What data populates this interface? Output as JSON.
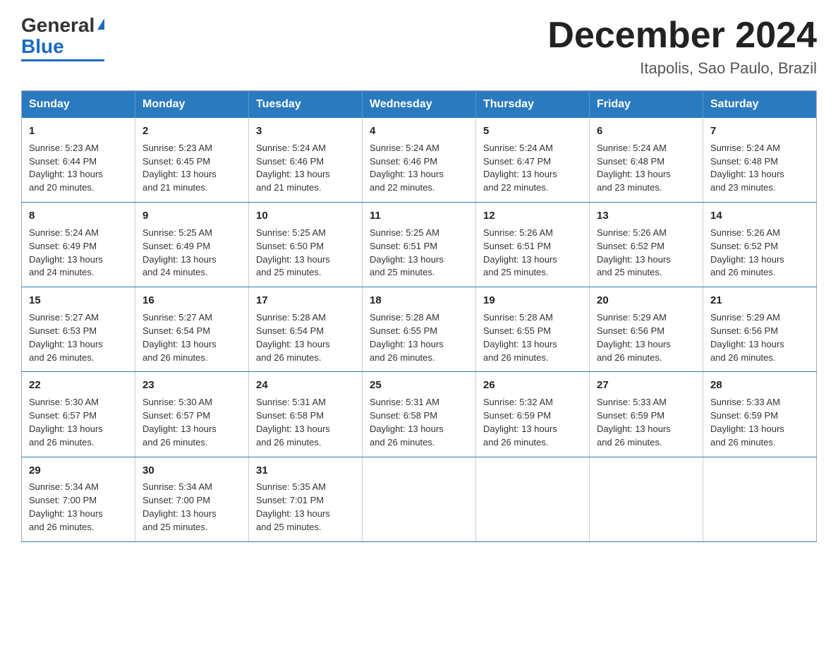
{
  "logo": {
    "general": "General",
    "blue": "Blue"
  },
  "title": "December 2024",
  "subtitle": "Itapolis, Sao Paulo, Brazil",
  "weekdays": [
    "Sunday",
    "Monday",
    "Tuesday",
    "Wednesday",
    "Thursday",
    "Friday",
    "Saturday"
  ],
  "weeks": [
    [
      {
        "day": "1",
        "sunrise": "5:23 AM",
        "sunset": "6:44 PM",
        "daylight": "13 hours and 20 minutes."
      },
      {
        "day": "2",
        "sunrise": "5:23 AM",
        "sunset": "6:45 PM",
        "daylight": "13 hours and 21 minutes."
      },
      {
        "day": "3",
        "sunrise": "5:24 AM",
        "sunset": "6:46 PM",
        "daylight": "13 hours and 21 minutes."
      },
      {
        "day": "4",
        "sunrise": "5:24 AM",
        "sunset": "6:46 PM",
        "daylight": "13 hours and 22 minutes."
      },
      {
        "day": "5",
        "sunrise": "5:24 AM",
        "sunset": "6:47 PM",
        "daylight": "13 hours and 22 minutes."
      },
      {
        "day": "6",
        "sunrise": "5:24 AM",
        "sunset": "6:48 PM",
        "daylight": "13 hours and 23 minutes."
      },
      {
        "day": "7",
        "sunrise": "5:24 AM",
        "sunset": "6:48 PM",
        "daylight": "13 hours and 23 minutes."
      }
    ],
    [
      {
        "day": "8",
        "sunrise": "5:24 AM",
        "sunset": "6:49 PM",
        "daylight": "13 hours and 24 minutes."
      },
      {
        "day": "9",
        "sunrise": "5:25 AM",
        "sunset": "6:49 PM",
        "daylight": "13 hours and 24 minutes."
      },
      {
        "day": "10",
        "sunrise": "5:25 AM",
        "sunset": "6:50 PM",
        "daylight": "13 hours and 25 minutes."
      },
      {
        "day": "11",
        "sunrise": "5:25 AM",
        "sunset": "6:51 PM",
        "daylight": "13 hours and 25 minutes."
      },
      {
        "day": "12",
        "sunrise": "5:26 AM",
        "sunset": "6:51 PM",
        "daylight": "13 hours and 25 minutes."
      },
      {
        "day": "13",
        "sunrise": "5:26 AM",
        "sunset": "6:52 PM",
        "daylight": "13 hours and 25 minutes."
      },
      {
        "day": "14",
        "sunrise": "5:26 AM",
        "sunset": "6:52 PM",
        "daylight": "13 hours and 26 minutes."
      }
    ],
    [
      {
        "day": "15",
        "sunrise": "5:27 AM",
        "sunset": "6:53 PM",
        "daylight": "13 hours and 26 minutes."
      },
      {
        "day": "16",
        "sunrise": "5:27 AM",
        "sunset": "6:54 PM",
        "daylight": "13 hours and 26 minutes."
      },
      {
        "day": "17",
        "sunrise": "5:28 AM",
        "sunset": "6:54 PM",
        "daylight": "13 hours and 26 minutes."
      },
      {
        "day": "18",
        "sunrise": "5:28 AM",
        "sunset": "6:55 PM",
        "daylight": "13 hours and 26 minutes."
      },
      {
        "day": "19",
        "sunrise": "5:28 AM",
        "sunset": "6:55 PM",
        "daylight": "13 hours and 26 minutes."
      },
      {
        "day": "20",
        "sunrise": "5:29 AM",
        "sunset": "6:56 PM",
        "daylight": "13 hours and 26 minutes."
      },
      {
        "day": "21",
        "sunrise": "5:29 AM",
        "sunset": "6:56 PM",
        "daylight": "13 hours and 26 minutes."
      }
    ],
    [
      {
        "day": "22",
        "sunrise": "5:30 AM",
        "sunset": "6:57 PM",
        "daylight": "13 hours and 26 minutes."
      },
      {
        "day": "23",
        "sunrise": "5:30 AM",
        "sunset": "6:57 PM",
        "daylight": "13 hours and 26 minutes."
      },
      {
        "day": "24",
        "sunrise": "5:31 AM",
        "sunset": "6:58 PM",
        "daylight": "13 hours and 26 minutes."
      },
      {
        "day": "25",
        "sunrise": "5:31 AM",
        "sunset": "6:58 PM",
        "daylight": "13 hours and 26 minutes."
      },
      {
        "day": "26",
        "sunrise": "5:32 AM",
        "sunset": "6:59 PM",
        "daylight": "13 hours and 26 minutes."
      },
      {
        "day": "27",
        "sunrise": "5:33 AM",
        "sunset": "6:59 PM",
        "daylight": "13 hours and 26 minutes."
      },
      {
        "day": "28",
        "sunrise": "5:33 AM",
        "sunset": "6:59 PM",
        "daylight": "13 hours and 26 minutes."
      }
    ],
    [
      {
        "day": "29",
        "sunrise": "5:34 AM",
        "sunset": "7:00 PM",
        "daylight": "13 hours and 26 minutes."
      },
      {
        "day": "30",
        "sunrise": "5:34 AM",
        "sunset": "7:00 PM",
        "daylight": "13 hours and 25 minutes."
      },
      {
        "day": "31",
        "sunrise": "5:35 AM",
        "sunset": "7:01 PM",
        "daylight": "13 hours and 25 minutes."
      },
      null,
      null,
      null,
      null
    ]
  ],
  "labels": {
    "sunrise_prefix": "Sunrise: ",
    "sunset_prefix": "Sunset: ",
    "daylight_prefix": "Daylight: "
  }
}
